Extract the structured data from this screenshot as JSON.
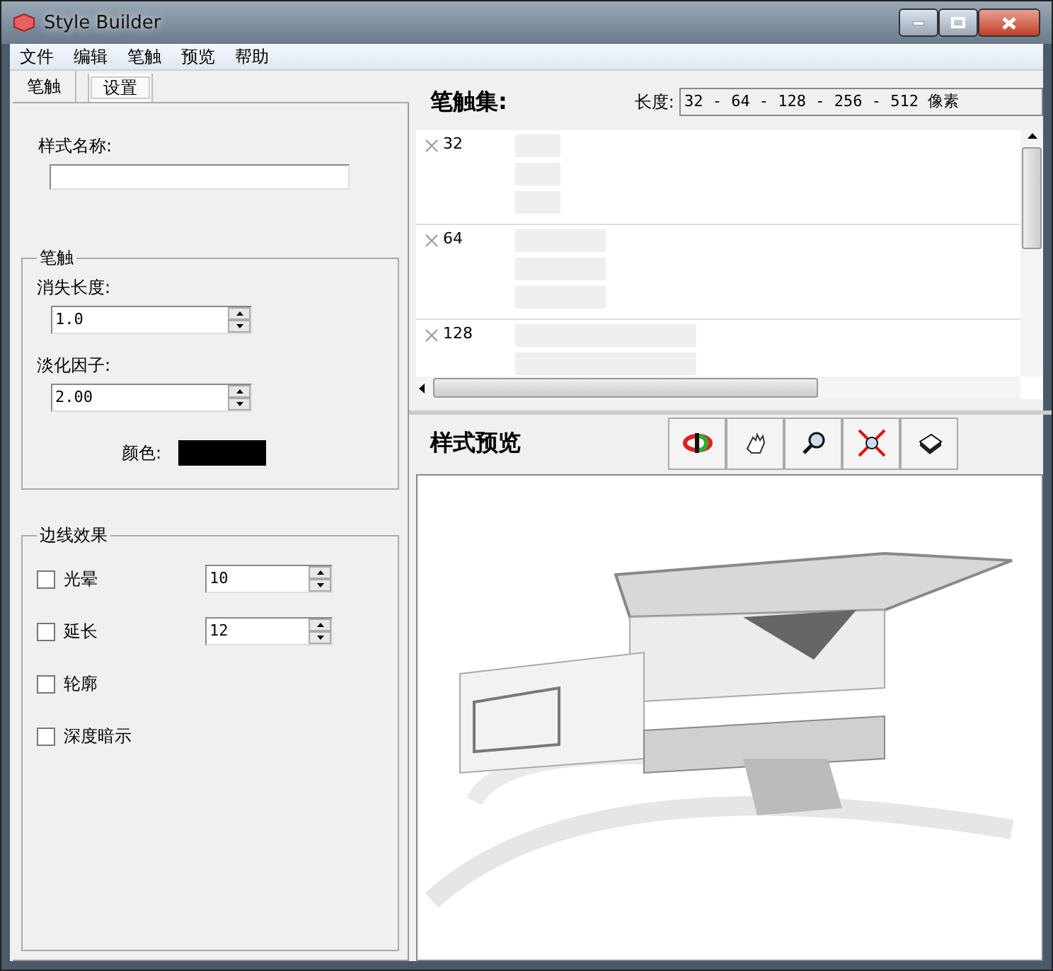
{
  "window": {
    "title": "Style Builder"
  },
  "menu": [
    "文件",
    "编辑",
    "笔触",
    "预览",
    "帮助"
  ],
  "tabs": [
    {
      "label": "笔触",
      "selected": true
    },
    {
      "label": "设置",
      "selected": false
    }
  ],
  "style_name": {
    "label": "样式名称:"
  },
  "stroke_group": {
    "title": "笔触",
    "fields": [
      {
        "label": "消失长度:",
        "value": "1.0"
      },
      {
        "label": "淡化因子:",
        "value": "2.00"
      }
    ],
    "color_label": "颜色:",
    "color": "#000000"
  },
  "edge_group": {
    "title": "边线效果",
    "options": [
      {
        "label": "光晕",
        "checked": false,
        "value": "10"
      },
      {
        "label": "延长",
        "checked": false,
        "value": "12"
      },
      {
        "label": "轮廓",
        "checked": false
      },
      {
        "label": "深度暗示",
        "checked": false
      }
    ]
  },
  "stroke_set": {
    "title": "笔触集:",
    "length_label": "长度:",
    "length_value": "32 - 64 - 128 - 256 - 512 像素",
    "rows": [
      {
        "label": "32"
      },
      {
        "label": "64"
      },
      {
        "label": "128"
      }
    ]
  },
  "preview": {
    "title": "样式预览"
  }
}
